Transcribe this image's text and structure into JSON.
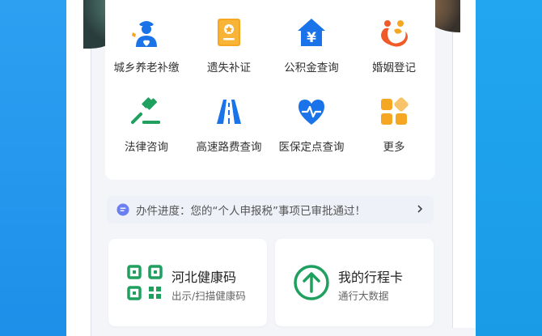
{
  "services": [
    {
      "label": "城乡养老补缴",
      "icon": "elderly-care-icon"
    },
    {
      "label": "遗失补证",
      "icon": "lost-certificate-icon"
    },
    {
      "label": "公积金查询",
      "icon": "housing-fund-icon"
    },
    {
      "label": "婚姻登记",
      "icon": "marriage-registration-icon"
    },
    {
      "label": "法律咨询",
      "icon": "legal-gavel-icon"
    },
    {
      "label": "高速路费查询",
      "icon": "highway-icon"
    },
    {
      "label": "医保定点查询",
      "icon": "medical-heart-icon"
    },
    {
      "label": "更多",
      "icon": "more-grid-icon"
    }
  ],
  "notice": {
    "text": "办件进度：您的“个人申报税”事项已审批通过！"
  },
  "cards": [
    {
      "title": "河北健康码",
      "subtitle": "出示/扫描健康码",
      "icon": "qr-code-icon"
    },
    {
      "title": "我的行程卡",
      "subtitle": "通行大数据",
      "icon": "arrow-up-circle-icon"
    }
  ],
  "colors": {
    "blue": "#1a73e8",
    "orange": "#f5a623",
    "green": "#1fa05f",
    "background": "#1c8be8"
  }
}
